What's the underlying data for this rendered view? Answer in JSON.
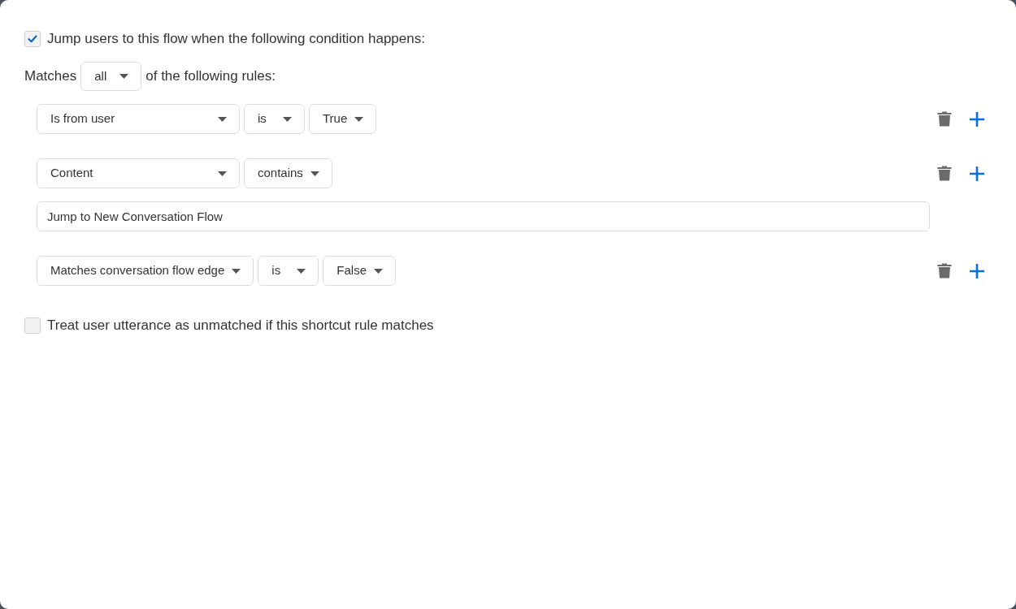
{
  "jump_condition": {
    "label": "Jump users to this flow when the following condition happens:",
    "checked": true
  },
  "matches": {
    "prefix": "Matches",
    "value": "all",
    "suffix": "of the following rules:"
  },
  "rules": [
    {
      "dropdowns": [
        "Is from user",
        "is",
        "True"
      ]
    },
    {
      "dropdowns": [
        "Content",
        "contains"
      ],
      "input_value": "Jump to New Conversation Flow"
    },
    {
      "dropdowns": [
        "Matches conversation flow edge",
        "is",
        "False"
      ]
    }
  ],
  "treat_unmatched": {
    "label": "Treat user utterance as unmatched if this shortcut rule matches",
    "checked": false
  }
}
